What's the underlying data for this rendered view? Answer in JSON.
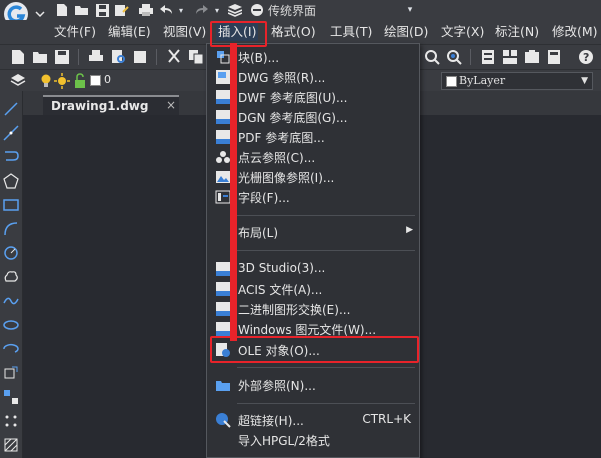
{
  "titlebar": {
    "workspace": "传统界面"
  },
  "menubar": {
    "items": [
      {
        "label": "文件(F)"
      },
      {
        "label": "编辑(E)"
      },
      {
        "label": "视图(V)"
      },
      {
        "label": "插入(I)"
      },
      {
        "label": "格式(O)"
      },
      {
        "label": "工具(T)"
      },
      {
        "label": "绘图(D)"
      },
      {
        "label": "文字(X)"
      },
      {
        "label": "标注(N)"
      },
      {
        "label": "修改(M)"
      }
    ]
  },
  "layerbar": {
    "layer_name": "0",
    "linetype": "ByLayer"
  },
  "tab": {
    "title": "Drawing1.dwg",
    "close": "×"
  },
  "insert_menu": {
    "items": [
      {
        "label": "块(B)...",
        "icon": "block-icon"
      },
      {
        "label": "DWG 参照(R)...",
        "icon": "dwg-ref-icon"
      },
      {
        "label": "DWF 参考底图(U)...",
        "icon": "dwf-underlay-icon"
      },
      {
        "label": "DGN 参考底图(G)...",
        "icon": "dgn-underlay-icon"
      },
      {
        "label": "PDF 参考底图...",
        "icon": "pdf-underlay-icon"
      },
      {
        "label": "点云参照(C)...",
        "icon": "point-cloud-icon"
      },
      {
        "label": "光栅图像参照(I)...",
        "icon": "raster-image-icon"
      },
      {
        "label": "字段(F)...",
        "icon": "field-icon"
      },
      {
        "label": "布局(L)",
        "submenu": "▶"
      },
      {
        "label": "3D Studio(3)...",
        "icon": "3ds-icon"
      },
      {
        "label": "ACIS 文件(A)...",
        "icon": "acis-icon"
      },
      {
        "label": "二进制图形交换(E)...",
        "icon": "dxb-icon"
      },
      {
        "label": "Windows 图元文件(W)...",
        "icon": "wmf-icon"
      },
      {
        "label": "OLE 对象(O)...",
        "icon": "ole-icon"
      },
      {
        "label": "外部参照(N)...",
        "icon": "xref-icon"
      },
      {
        "label": "超链接(H)...",
        "icon": "hyperlink-icon",
        "shortcut": "CTRL+K"
      },
      {
        "label": "导入HPGL/2格式"
      }
    ]
  },
  "colors": {
    "highlight": "#e8232a",
    "background": "#282a30",
    "panel": "#3a3c41"
  }
}
